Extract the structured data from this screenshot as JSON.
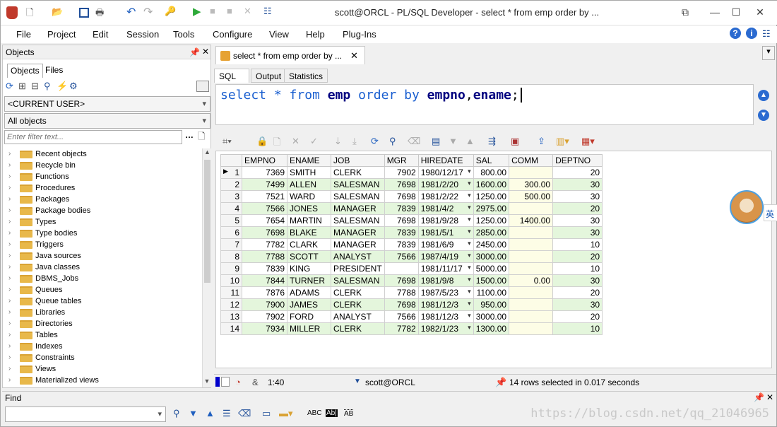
{
  "window": {
    "title": "scott@ORCL - PL/SQL Developer - select * from emp order by ...",
    "controls": [
      "restore-icon",
      "minimize-icon",
      "maximize-icon",
      "close-icon"
    ]
  },
  "menu": [
    "File",
    "Project",
    "Edit",
    "Session",
    "Tools",
    "Configure",
    "View",
    "Help",
    "Plug-Ins"
  ],
  "objects_panel": {
    "title": "Objects",
    "tabs": [
      "Objects",
      "Files"
    ],
    "user_combo": "<CURRENT USER>",
    "filter_combo": "All objects",
    "filter_placeholder": "Enter filter text...",
    "tree": [
      "Recent objects",
      "Recycle bin",
      "Functions",
      "Procedures",
      "Packages",
      "Package bodies",
      "Types",
      "Type bodies",
      "Triggers",
      "Java sources",
      "Java classes",
      "DBMS_Jobs",
      "Queues",
      "Queue tables",
      "Libraries",
      "Directories",
      "Tables",
      "Indexes",
      "Constraints",
      "Views",
      "Materialized views"
    ]
  },
  "document": {
    "tab_title": "select * from emp order by ...",
    "subtabs": [
      "SQL",
      "Output",
      "Statistics"
    ],
    "sql": {
      "t1": "select",
      "t2": " * ",
      "t3": "from",
      "t4": " ",
      "t5": "emp",
      "t6": " ",
      "t7": "order by",
      "t8": " ",
      "t9": "empno",
      "t10": ",",
      "t11": "ename",
      "t12": ";"
    }
  },
  "grid": {
    "columns": [
      "EMPNO",
      "ENAME",
      "JOB",
      "MGR",
      "HIREDATE",
      "SAL",
      "COMM",
      "DEPTNO"
    ],
    "rows": [
      [
        "1",
        "7369",
        "SMITH",
        "CLERK",
        "7902",
        "1980/12/17",
        "800.00",
        "",
        "20"
      ],
      [
        "2",
        "7499",
        "ALLEN",
        "SALESMAN",
        "7698",
        "1981/2/20",
        "1600.00",
        "300.00",
        "30"
      ],
      [
        "3",
        "7521",
        "WARD",
        "SALESMAN",
        "7698",
        "1981/2/22",
        "1250.00",
        "500.00",
        "30"
      ],
      [
        "4",
        "7566",
        "JONES",
        "MANAGER",
        "7839",
        "1981/4/2",
        "2975.00",
        "",
        "20"
      ],
      [
        "5",
        "7654",
        "MARTIN",
        "SALESMAN",
        "7698",
        "1981/9/28",
        "1250.00",
        "1400.00",
        "30"
      ],
      [
        "6",
        "7698",
        "BLAKE",
        "MANAGER",
        "7839",
        "1981/5/1",
        "2850.00",
        "",
        "30"
      ],
      [
        "7",
        "7782",
        "CLARK",
        "MANAGER",
        "7839",
        "1981/6/9",
        "2450.00",
        "",
        "10"
      ],
      [
        "8",
        "7788",
        "SCOTT",
        "ANALYST",
        "7566",
        "1987/4/19",
        "3000.00",
        "",
        "20"
      ],
      [
        "9",
        "7839",
        "KING",
        "PRESIDENT",
        "",
        "1981/11/17",
        "5000.00",
        "",
        "10"
      ],
      [
        "10",
        "7844",
        "TURNER",
        "SALESMAN",
        "7698",
        "1981/9/8",
        "1500.00",
        "0.00",
        "30"
      ],
      [
        "11",
        "7876",
        "ADAMS",
        "CLERK",
        "7788",
        "1987/5/23",
        "1100.00",
        "",
        "20"
      ],
      [
        "12",
        "7900",
        "JAMES",
        "CLERK",
        "7698",
        "1981/12/3",
        "950.00",
        "",
        "30"
      ],
      [
        "13",
        "7902",
        "FORD",
        "ANALYST",
        "7566",
        "1981/12/3",
        "3000.00",
        "",
        "20"
      ],
      [
        "14",
        "7934",
        "MILLER",
        "CLERK",
        "7782",
        "1982/1/23",
        "1300.00",
        "",
        "10"
      ]
    ]
  },
  "status": {
    "position": "1:40",
    "connection": "scott@ORCL",
    "message": "14 rows selected in 0.017 seconds"
  },
  "find": {
    "title": "Find",
    "opt_abc": "ABC",
    "opt_ab": "AB"
  },
  "overlay": {
    "ime_char": "英"
  },
  "watermark": "https://blog.csdn.net/qq_21046965"
}
